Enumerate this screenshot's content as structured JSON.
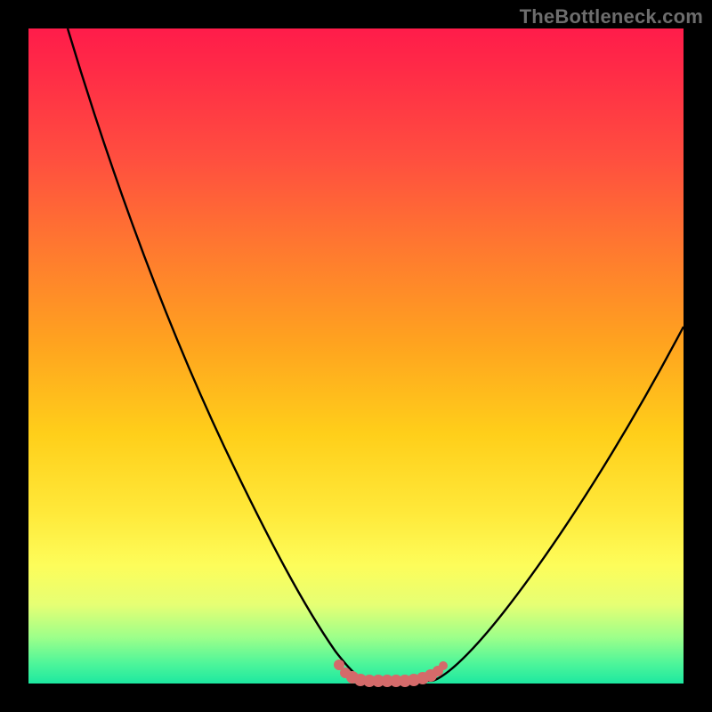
{
  "brand": "TheBottleneck.com",
  "colors": {
    "curve_stroke": "#000000",
    "marker_stroke": "#d46a6a",
    "marker_fill": "#d46a6a",
    "background_top": "#ff1c4a",
    "background_bottom": "#1de8a0",
    "frame": "#000000"
  },
  "chart_data": {
    "type": "line",
    "title": "",
    "xlabel": "",
    "ylabel": "",
    "xlim": [
      0,
      100
    ],
    "ylim": [
      0,
      100
    ],
    "grid": false,
    "legend": false,
    "series": [
      {
        "name": "bottleneck-curve-left",
        "x": [
          0,
          5,
          10,
          15,
          20,
          25,
          30,
          35,
          40,
          43,
          46,
          49,
          51
        ],
        "values": [
          100,
          92,
          82,
          72,
          62,
          52,
          42,
          32,
          21,
          13,
          7,
          2,
          0
        ]
      },
      {
        "name": "bottleneck-curve-right",
        "x": [
          62,
          65,
          70,
          75,
          80,
          85,
          90,
          95,
          100
        ],
        "values": [
          0,
          3,
          9,
          16,
          23,
          31,
          39,
          47,
          55
        ]
      },
      {
        "name": "optimal-range-markers",
        "x": [
          48,
          49,
          50,
          51,
          52,
          53,
          54,
          55,
          56,
          57,
          58,
          59,
          60,
          61,
          62
        ],
        "values": [
          2,
          0.6,
          0.3,
          0.2,
          0.2,
          0.2,
          0.2,
          0.2,
          0.2,
          0.3,
          0.4,
          0.5,
          0.8,
          1.3,
          2
        ]
      }
    ]
  }
}
